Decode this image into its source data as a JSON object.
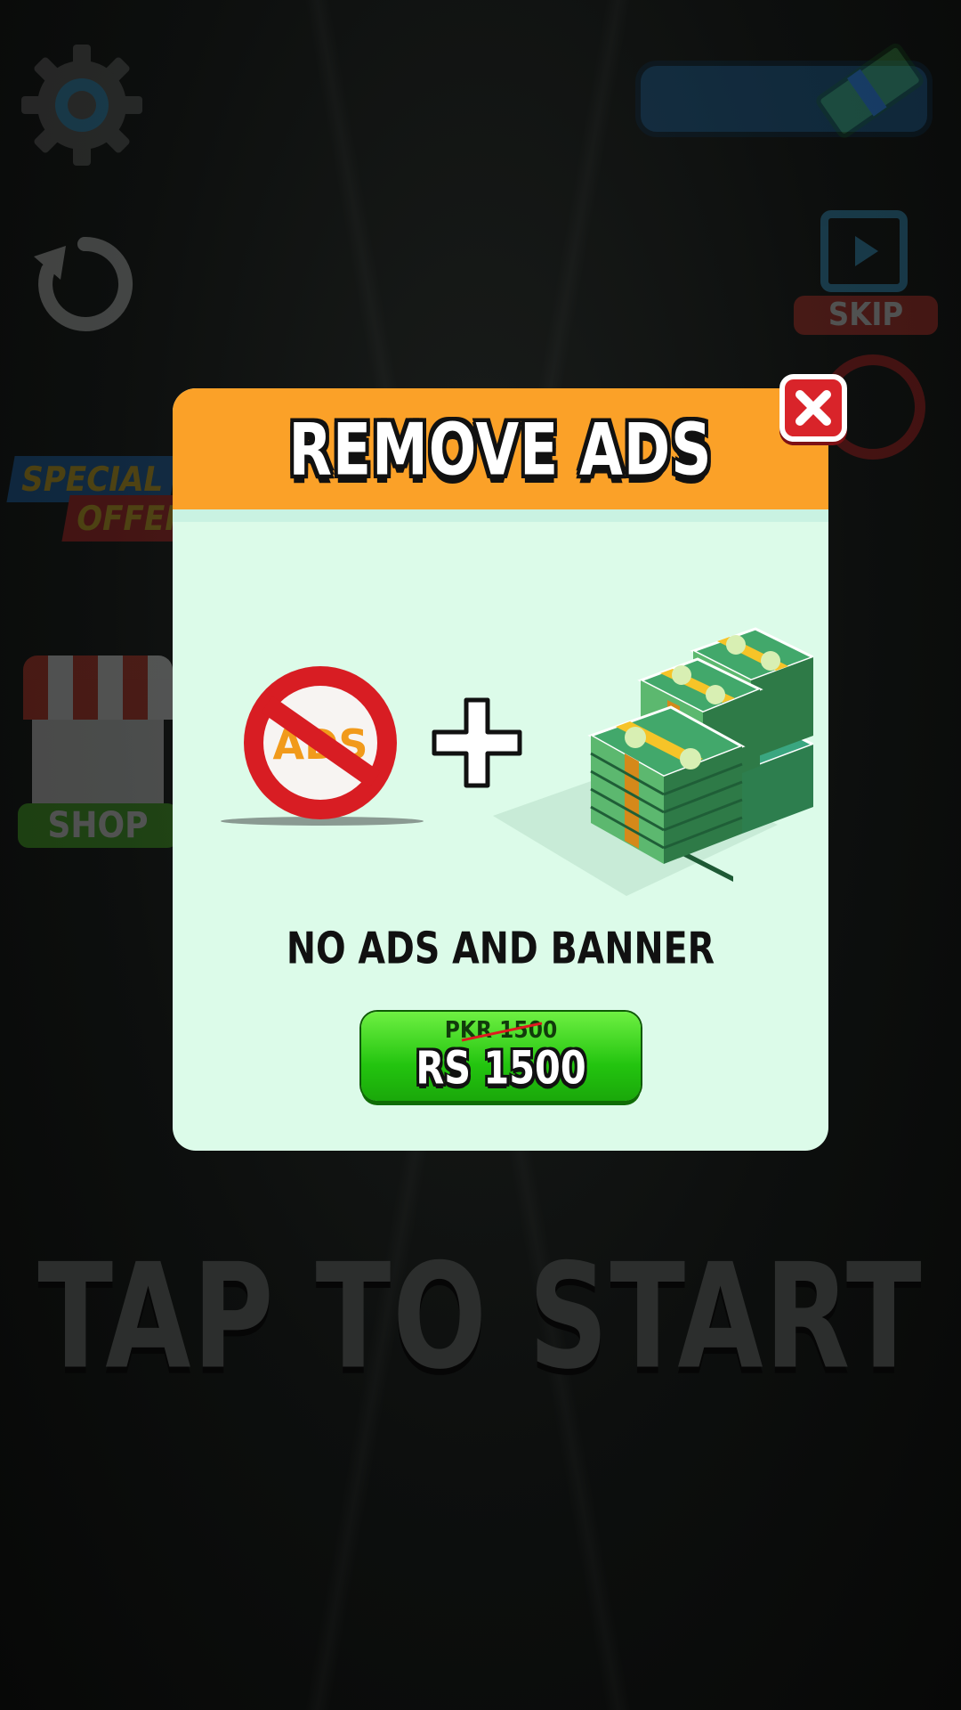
{
  "hud": {
    "skip_label": "SKIP",
    "special_offer_line1": "SPECIAL",
    "special_offer_line2": "OFFER",
    "shop_label": "SHOP",
    "tap_to_start": "TAP TO START"
  },
  "modal": {
    "title": "REMOVE ADS",
    "ads_icon_text": "ADS",
    "description": "NO ADS AND BANNER",
    "old_price": "PKR 1500",
    "price": "RS 1500"
  },
  "colors": {
    "header": "#fba128",
    "panel": "#dcfbe9",
    "buy_button": "#23c40f",
    "close_button": "#d9242a"
  },
  "icons": [
    "gear-icon",
    "restart-icon",
    "cash-icon",
    "film-icon",
    "no-ads-icon",
    "plus-icon",
    "close-icon",
    "shop-icon"
  ]
}
